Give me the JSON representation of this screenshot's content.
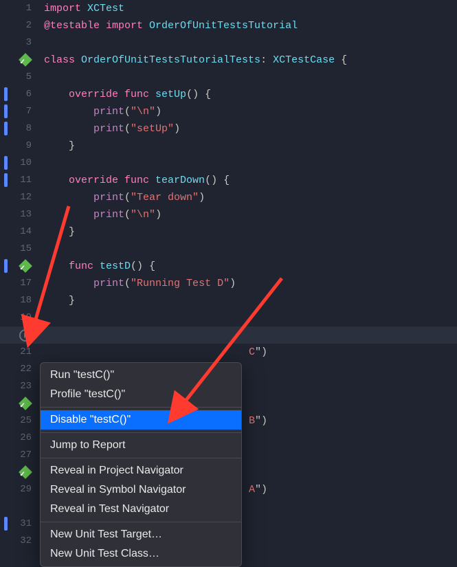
{
  "code": {
    "lines": [
      {
        "n": "1",
        "tokens": [
          [
            "keyword",
            "import "
          ],
          [
            "type",
            "XCTest"
          ]
        ]
      },
      {
        "n": "2",
        "tokens": [
          [
            "at",
            "@testable "
          ],
          [
            "keyword",
            "import "
          ],
          [
            "type",
            "OrderOfUnitTestsTutorial"
          ]
        ]
      },
      {
        "n": "3",
        "tokens": []
      },
      {
        "n": "4",
        "marker": "success-diamond",
        "tokens": [
          [
            "keyword",
            "class "
          ],
          [
            "type",
            "OrderOfUnitTestsTutorialTests"
          ],
          [
            "punc",
            ": "
          ],
          [
            "type",
            "XCTestCase"
          ],
          [
            "punc",
            " {"
          ]
        ]
      },
      {
        "n": "5",
        "tokens": []
      },
      {
        "n": "6",
        "blue": true,
        "tokens": [
          [
            "punc",
            "    "
          ],
          [
            "keyword",
            "override func "
          ],
          [
            "func",
            "setUp"
          ],
          [
            "punc",
            "() {"
          ]
        ]
      },
      {
        "n": "7",
        "blue": true,
        "tokens": [
          [
            "punc",
            "        "
          ],
          [
            "string-method",
            "print"
          ],
          [
            "punc",
            "("
          ],
          [
            "string",
            "\"\\n\""
          ],
          [
            "punc",
            ")"
          ]
        ]
      },
      {
        "n": "8",
        "blue": true,
        "tokens": [
          [
            "punc",
            "        "
          ],
          [
            "string-method",
            "print"
          ],
          [
            "punc",
            "("
          ],
          [
            "string",
            "\"setUp\""
          ],
          [
            "punc",
            ")"
          ]
        ]
      },
      {
        "n": "9",
        "tokens": [
          [
            "punc",
            "    }"
          ]
        ]
      },
      {
        "n": "10",
        "blue": true,
        "tokens": []
      },
      {
        "n": "11",
        "blue": true,
        "tokens": [
          [
            "punc",
            "    "
          ],
          [
            "keyword",
            "override func "
          ],
          [
            "func",
            "tearDown"
          ],
          [
            "punc",
            "() {"
          ]
        ]
      },
      {
        "n": "12",
        "tokens": [
          [
            "punc",
            "        "
          ],
          [
            "string-method",
            "print"
          ],
          [
            "punc",
            "("
          ],
          [
            "string",
            "\"Tear down\""
          ],
          [
            "punc",
            ")"
          ]
        ]
      },
      {
        "n": "13",
        "tokens": [
          [
            "punc",
            "        "
          ],
          [
            "string-method",
            "print"
          ],
          [
            "punc",
            "("
          ],
          [
            "string",
            "\"\\n\""
          ],
          [
            "punc",
            ")"
          ]
        ]
      },
      {
        "n": "14",
        "tokens": [
          [
            "punc",
            "    }"
          ]
        ]
      },
      {
        "n": "15",
        "tokens": []
      },
      {
        "n": "16",
        "marker": "success-diamond",
        "blue": true,
        "tokens": [
          [
            "punc",
            "    "
          ],
          [
            "keyword",
            "func "
          ],
          [
            "func",
            "testD"
          ],
          [
            "punc",
            "() {"
          ]
        ]
      },
      {
        "n": "17",
        "tokens": [
          [
            "punc",
            "        "
          ],
          [
            "string-method",
            "print"
          ],
          [
            "punc",
            "("
          ],
          [
            "string",
            "\"Running Test D\""
          ],
          [
            "punc",
            ")"
          ]
        ]
      },
      {
        "n": "18",
        "tokens": [
          [
            "punc",
            "    }"
          ]
        ]
      },
      {
        "n": "19",
        "tokens": []
      },
      {
        "n": "",
        "highlighted": true,
        "marker": "play-circle",
        "tokens": []
      },
      {
        "n": "21",
        "tail": "C\")",
        "tokens": []
      },
      {
        "n": "22",
        "tokens": []
      },
      {
        "n": "23",
        "tokens": []
      },
      {
        "n": "",
        "marker": "success-diamond",
        "tokens": []
      },
      {
        "n": "25",
        "tail": "B\")",
        "tokens": []
      },
      {
        "n": "26",
        "tokens": []
      },
      {
        "n": "27",
        "tokens": []
      },
      {
        "n": "",
        "marker": "success-diamond",
        "tokens": []
      },
      {
        "n": "29",
        "tail": "A\")",
        "tokens": []
      },
      {
        "n": "",
        "tokens": []
      },
      {
        "n": "31",
        "blue": true,
        "tokens": []
      },
      {
        "n": "32",
        "tokens": []
      }
    ],
    "highlighted_line_index": 19
  },
  "contextMenu": {
    "items": [
      {
        "type": "item",
        "label": "Run \"testC()\""
      },
      {
        "type": "item",
        "label": "Profile \"testC()\""
      },
      {
        "type": "sep"
      },
      {
        "type": "item",
        "label": "Disable \"testC()\"",
        "selected": true
      },
      {
        "type": "sep"
      },
      {
        "type": "item",
        "label": "Jump to Report"
      },
      {
        "type": "sep"
      },
      {
        "type": "item",
        "label": "Reveal in Project Navigator"
      },
      {
        "type": "item",
        "label": "Reveal in Symbol Navigator"
      },
      {
        "type": "item",
        "label": "Reveal in Test Navigator"
      },
      {
        "type": "sep"
      },
      {
        "type": "item",
        "label": "New Unit Test Target…"
      },
      {
        "type": "item",
        "label": "New Unit Test Class…"
      }
    ]
  },
  "arrows": {
    "color": "#ff3b30"
  }
}
